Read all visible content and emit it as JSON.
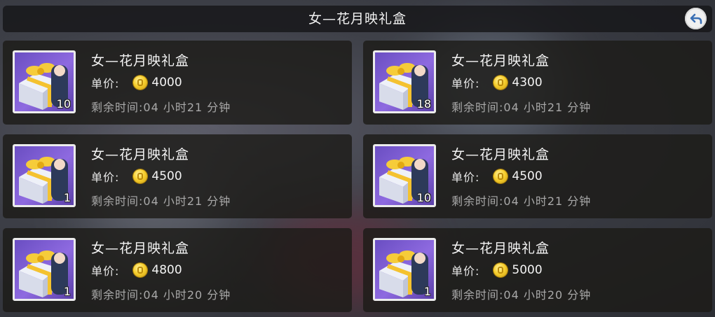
{
  "header": {
    "title": "女—花月映礼盒"
  },
  "listings": [
    {
      "name": "女—花月映礼盒",
      "price_label": "单价:",
      "price": "4000",
      "time_label": "剩余时间:",
      "time_left": "04 小时21 分钟",
      "quantity": "10"
    },
    {
      "name": "女—花月映礼盒",
      "price_label": "单价:",
      "price": "4300",
      "time_label": "剩余时间:",
      "time_left": "04 小时21 分钟",
      "quantity": "18"
    },
    {
      "name": "女—花月映礼盒",
      "price_label": "单价:",
      "price": "4500",
      "time_label": "剩余时间:",
      "time_left": "04 小时21 分钟",
      "quantity": "1"
    },
    {
      "name": "女—花月映礼盒",
      "price_label": "单价:",
      "price": "4500",
      "time_label": "剩余时间:",
      "time_left": "04 小时21 分钟",
      "quantity": "10"
    },
    {
      "name": "女—花月映礼盒",
      "price_label": "单价:",
      "price": "4800",
      "time_label": "剩余时间:",
      "time_left": "04 小时20 分钟",
      "quantity": "1"
    },
    {
      "name": "女—花月映礼盒",
      "price_label": "单价:",
      "price": "5000",
      "time_label": "剩余时间:",
      "time_left": "04 小时20 分钟",
      "quantity": "1"
    }
  ],
  "icons": {
    "back": "back-arrow-icon",
    "coin": "gold-coin-icon",
    "item": "gift-box-icon"
  }
}
